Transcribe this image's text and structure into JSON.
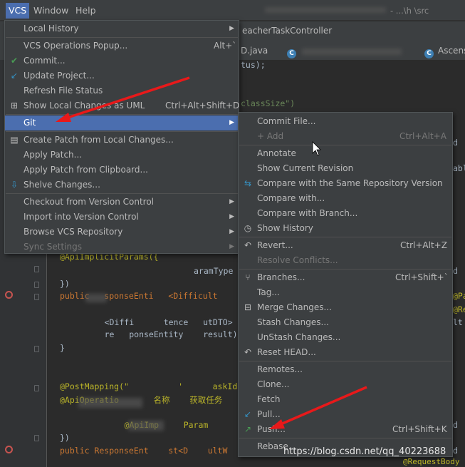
{
  "menubar": {
    "vcs": "VCS",
    "window": "Window",
    "help": "Help",
    "title_tail": "- ...\\h            \\src"
  },
  "tabs": {
    "controller": "eacherTaskController",
    "tab1": "D.java",
    "tab2": "Ascens"
  },
  "code": {
    "l1": "tus);",
    "l2": "classSize\")",
    "l3": "@ApiImplicitParams({",
    "l4": "aramType",
    "l5": "})",
    "l6": "public   sponseEnti   <Difficult",
    "l7": "     <Diffi      tence   utDTO>",
    "l8": "     re   ponseEntity    result)",
    "l9": "}",
    "l10": "@PostMapping(\"          '      askId}",
    "l11": "@ApiOperatio       名称    获取任务",
    "l12": "     @ApiImp     Param        Type",
    "l13": "})",
    "l14": "public ResponseEnt    st<D    ultW",
    "r1": "d",
    "r2": "able",
    "r3": "d",
    "r4": "@Pat",
    "r5": "@Req",
    "r6": "lt",
    "r7": "d",
    "r8": "d"
  },
  "vcs_menu": {
    "items": [
      {
        "label": "Local History"
      },
      {
        "label": "VCS Operations Popup...",
        "shortcut": "Alt+`"
      },
      {
        "label": "Commit..."
      },
      {
        "label": "Update Project..."
      },
      {
        "label": "Refresh File Status"
      },
      {
        "label": "Show Local Changes as UML",
        "shortcut": "Ctrl+Alt+Shift+D"
      },
      {
        "label": "Git"
      },
      {
        "label": "Create Patch from Local Changes..."
      },
      {
        "label": "Apply Patch..."
      },
      {
        "label": "Apply Patch from Clipboard..."
      },
      {
        "label": "Shelve Changes..."
      },
      {
        "label": "Checkout from Version Control"
      },
      {
        "label": "Import into Version Control"
      },
      {
        "label": "Browse VCS Repository"
      },
      {
        "label": "Sync Settings"
      }
    ]
  },
  "git_menu": {
    "items": [
      {
        "label": "Commit File..."
      },
      {
        "label": "+ Add",
        "shortcut": "Ctrl+Alt+A"
      },
      {
        "label": "Annotate"
      },
      {
        "label": "Show Current Revision"
      },
      {
        "label": "Compare with the Same Repository Version"
      },
      {
        "label": "Compare with..."
      },
      {
        "label": "Compare with Branch..."
      },
      {
        "label": "Show History"
      },
      {
        "label": "Revert...",
        "shortcut": "Ctrl+Alt+Z"
      },
      {
        "label": "Resolve Conflicts..."
      },
      {
        "label": "Branches...",
        "shortcut": "Ctrl+Shift+`"
      },
      {
        "label": "Tag..."
      },
      {
        "label": "Merge Changes..."
      },
      {
        "label": "Stash Changes..."
      },
      {
        "label": "UnStash Changes..."
      },
      {
        "label": "Reset HEAD..."
      },
      {
        "label": "Remotes..."
      },
      {
        "label": "Clone..."
      },
      {
        "label": "Fetch"
      },
      {
        "label": "Pull..."
      },
      {
        "label": "Push...",
        "shortcut": "Ctrl+Shift+K"
      },
      {
        "label": "Rebase..."
      }
    ]
  },
  "watermark": "https://blog.csdn.net/qq_40223688",
  "annotation_tag": "@RequestBody",
  "colors": {
    "selection": "#4b6eaf",
    "menu_bg": "#3c3f41",
    "editor_bg": "#2b2b2b",
    "red_arrow": "#e8191a"
  }
}
